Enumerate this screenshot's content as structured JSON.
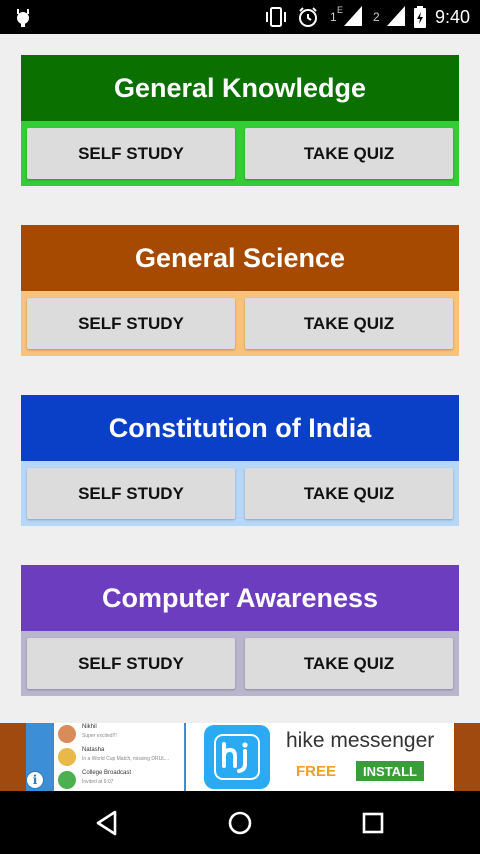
{
  "status_bar": {
    "time": "9:40",
    "sim1_label": "1",
    "sim1_net": "E",
    "sim2_label": "2"
  },
  "categories": [
    {
      "title": "General Knowledge",
      "self_study_label": "SELF STUDY",
      "take_quiz_label": "TAKE QUIZ",
      "header_color": "#0a7000",
      "footer_color": "#35cc35"
    },
    {
      "title": "General Science",
      "self_study_label": "SELF STUDY",
      "take_quiz_label": "TAKE QUIZ",
      "header_color": "#a54a00",
      "footer_color": "#f8c27a"
    },
    {
      "title": "Constitution of India",
      "self_study_label": "SELF STUDY",
      "take_quiz_label": "TAKE QUIZ",
      "header_color": "#0a40c8",
      "footer_color": "#b7d7f8"
    },
    {
      "title": "Computer Awareness",
      "self_study_label": "SELF STUDY",
      "take_quiz_label": "TAKE QUIZ",
      "header_color": "#6d3dbf",
      "footer_color": "#b9b5cd"
    }
  ],
  "ad": {
    "title": "hike messenger",
    "free_label": "FREE",
    "install_label": "INSTALL",
    "info_label": "i",
    "preview_rows": [
      {
        "name": "Nikhil",
        "text": "Super excited!!!",
        "color": "#d98b5a"
      },
      {
        "name": "Natasha",
        "text": "In a World Cup Match, missing DRUL...",
        "color": "#e8b84a"
      },
      {
        "name": "College Broadcast",
        "text": "Invited at 6:07",
        "color": "#4caf50"
      }
    ]
  },
  "icons": {
    "status_left": "debug-bug-icon",
    "vibrate": "vibrate-icon",
    "alarm": "alarm-icon",
    "battery": "battery-icon",
    "back": "back-triangle-icon",
    "home": "home-circle-icon",
    "recents": "recents-square-icon"
  }
}
